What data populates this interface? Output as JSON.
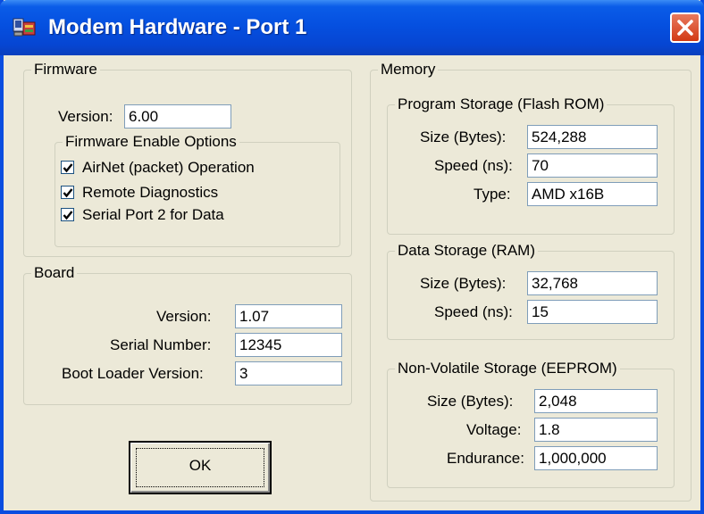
{
  "window": {
    "title": "Modem Hardware - Port  1",
    "icon": "modem-hardware-icon",
    "close_icon": "close-icon"
  },
  "firmware": {
    "legend": "Firmware",
    "version_label": "Version:",
    "version_value": "6.00",
    "enable_options": {
      "legend": "Firmware Enable Options",
      "options": [
        {
          "label": "AirNet (packet) Operation",
          "checked": true
        },
        {
          "label": "Remote Diagnostics",
          "checked": true
        },
        {
          "label": "Serial Port 2 for Data",
          "checked": true
        }
      ]
    }
  },
  "board": {
    "legend": "Board",
    "version_label": "Version:",
    "version_value": "1.07",
    "serial_label": "Serial Number:",
    "serial_value": "12345",
    "boot_label": "Boot Loader Version:",
    "boot_value": "3"
  },
  "memory": {
    "legend": "Memory",
    "program": {
      "legend": "Program Storage (Flash ROM)",
      "size_label": "Size (Bytes):",
      "size_value": "524,288",
      "speed_label": "Speed (ns):",
      "speed_value": "70",
      "type_label": "Type:",
      "type_value": "AMD x16B"
    },
    "data": {
      "legend": "Data Storage (RAM)",
      "size_label": "Size (Bytes):",
      "size_value": "32,768",
      "speed_label": "Speed (ns):",
      "speed_value": "15"
    },
    "eeprom": {
      "legend": "Non-Volatile Storage (EEPROM)",
      "size_label": "Size (Bytes):",
      "size_value": "2,048",
      "voltage_label": "Voltage:",
      "voltage_value": "1.8",
      "endurance_label": "Endurance:",
      "endurance_value": "1,000,000"
    }
  },
  "buttons": {
    "ok_label": "OK"
  },
  "colors": {
    "titlebar": "#0550e0",
    "dialog_bg": "#ece9d8",
    "close_button": "#d23a14",
    "field_border": "#7f9db9"
  }
}
